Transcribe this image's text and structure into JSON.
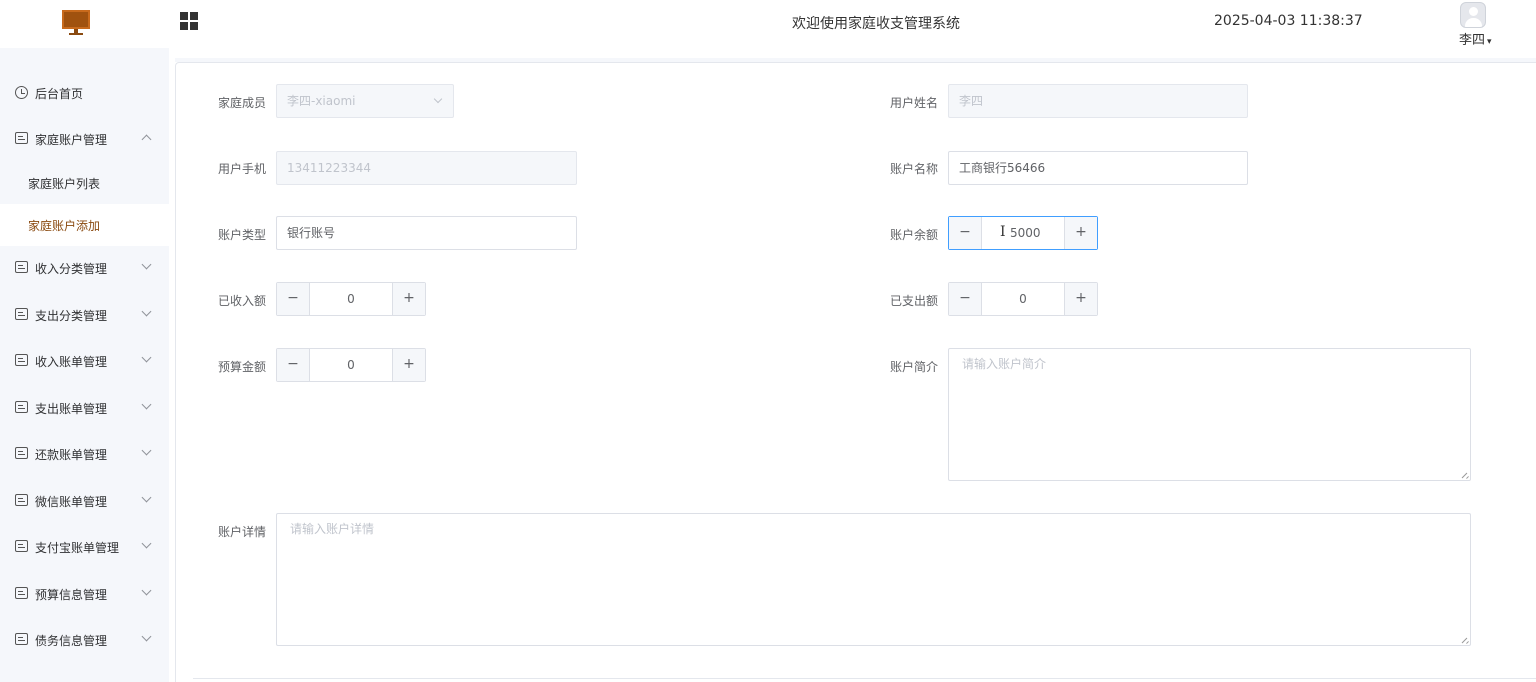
{
  "header": {
    "title": "欢迎使用家庭收支管理系统",
    "datetime": "2025-04-03 11:38:37",
    "user": "李四",
    "logo_color": "#a0520f"
  },
  "sidebar": {
    "items": [
      {
        "label": "后台首页",
        "icon": "clock-icon"
      },
      {
        "label": "家庭账户管理",
        "icon": "card-icon",
        "expanded": true
      },
      {
        "label": "收入分类管理",
        "icon": "card-icon"
      },
      {
        "label": "支出分类管理",
        "icon": "card-icon"
      },
      {
        "label": "收入账单管理",
        "icon": "card-icon"
      },
      {
        "label": "支出账单管理",
        "icon": "card-icon"
      },
      {
        "label": "还款账单管理",
        "icon": "card-icon"
      },
      {
        "label": "微信账单管理",
        "icon": "card-icon"
      },
      {
        "label": "支付宝账单管理",
        "icon": "card-icon"
      },
      {
        "label": "预算信息管理",
        "icon": "card-icon"
      },
      {
        "label": "债务信息管理",
        "icon": "card-icon"
      }
    ],
    "sub_items": [
      {
        "label": "家庭账户列表",
        "active": false
      },
      {
        "label": "家庭账户添加",
        "active": true
      }
    ],
    "active_color": "#8a4a10"
  },
  "form": {
    "family_member": {
      "label": "家庭成员",
      "value": "李四-xiaomi"
    },
    "user_name": {
      "label": "用户姓名",
      "value": "李四"
    },
    "user_phone": {
      "label": "用户手机",
      "value": "13411223344"
    },
    "account_name": {
      "label": "账户名称",
      "value": "工商银行56466"
    },
    "account_type": {
      "label": "账户类型",
      "value": "银行账号"
    },
    "account_balance": {
      "label": "账户余额",
      "value": "5000"
    },
    "income_received": {
      "label": "已收入额",
      "value": "0"
    },
    "expense_paid": {
      "label": "已支出额",
      "value": "0"
    },
    "budget_amount": {
      "label": "预算金额",
      "value": "0"
    },
    "account_intro": {
      "label": "账户简介",
      "placeholder": "请输入账户简介"
    },
    "account_details": {
      "label": "账户详情",
      "placeholder": "请输入账户详情"
    },
    "stepper_minus": "−",
    "stepper_plus": "+",
    "focus_color": "#409eff"
  }
}
